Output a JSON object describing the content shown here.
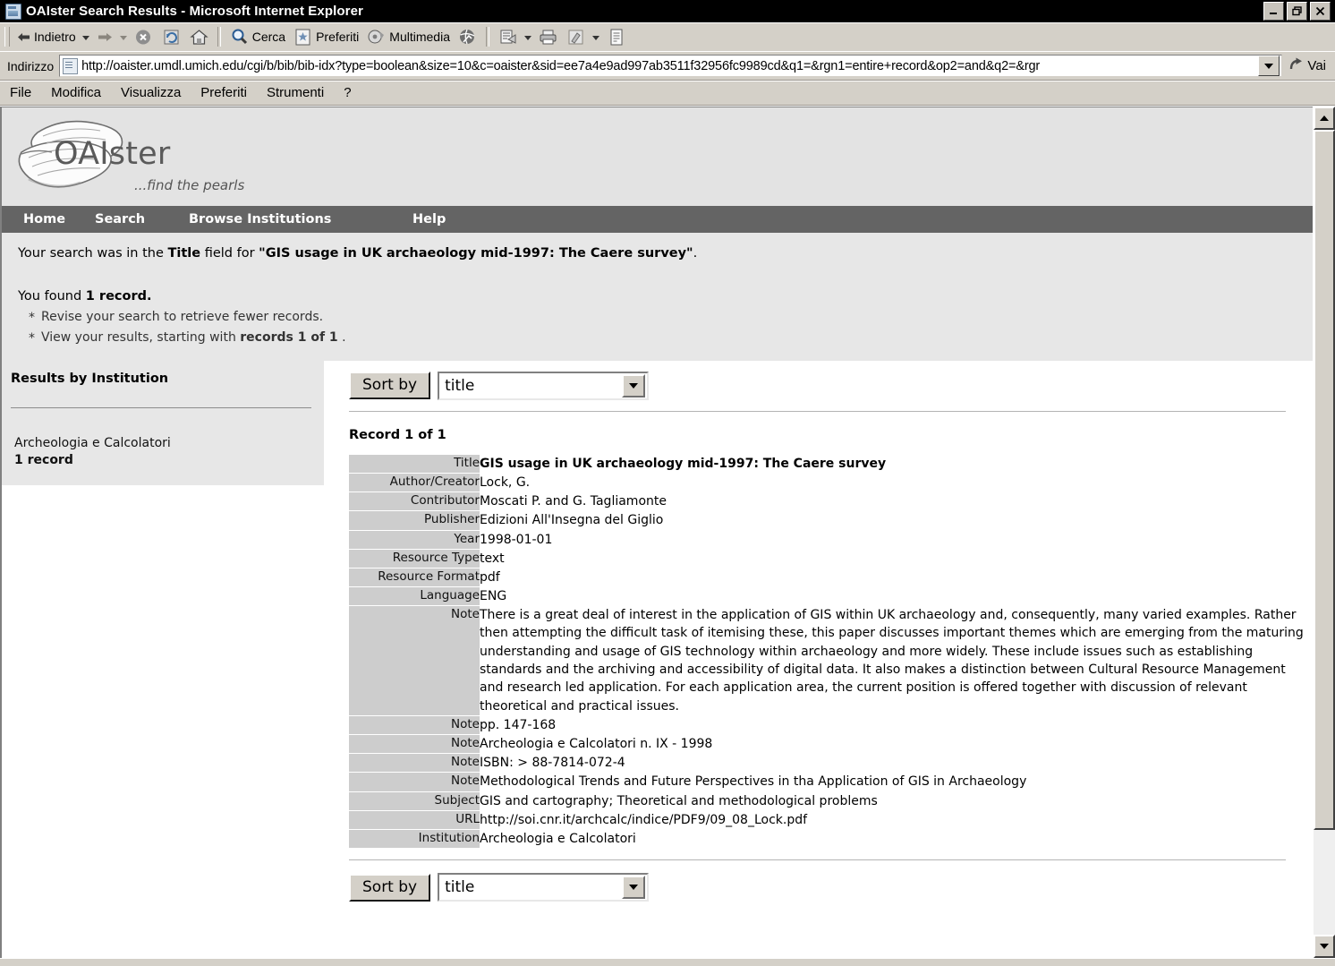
{
  "window": {
    "title": "OAIster Search Results - Microsoft Internet Explorer",
    "minimize_label": "_",
    "restore_label": "❐",
    "close_label": "×"
  },
  "toolbar": {
    "back_label": "Indietro",
    "search_label": "Cerca",
    "favorites_label": "Preferiti",
    "media_label": "Multimedia"
  },
  "address": {
    "label": "Indirizzo",
    "url": "http://oaister.umdl.umich.edu/cgi/b/bib/bib-idx?type=boolean&size=10&c=oaister&sid=ee7a4e9ad997ab3511f32956fc9989cd&q1=&rgn1=entire+record&op2=and&q2=&rgr",
    "go_label": "Vai"
  },
  "menubar": {
    "items": [
      {
        "label": "File"
      },
      {
        "label": "Modifica"
      },
      {
        "label": "Visualizza"
      },
      {
        "label": "Preferiti"
      },
      {
        "label": "Strumenti"
      },
      {
        "label": "?"
      }
    ]
  },
  "masthead": {
    "logo_text": "OAIster",
    "tagline": "...find the pearls"
  },
  "nav": {
    "items": [
      {
        "label": "Home"
      },
      {
        "label": "Search"
      },
      {
        "label": "Browse Institutions"
      },
      {
        "label": "Help"
      }
    ]
  },
  "summary": {
    "line1_prefix": "Your search was in the ",
    "line1_field": "Title",
    "line1_mid": " field for ",
    "line1_query": "\"GIS usage in UK archaeology mid-1997: The Caere survey\"",
    "line1_suffix": ".",
    "found_prefix": "You found ",
    "found_count": "1 record.",
    "bullets": [
      {
        "text": "Revise your search to retrieve fewer records."
      }
    ],
    "bullet2_prefix": "View your results, starting with ",
    "bullet2_bold": "records 1 of 1",
    "bullet2_suffix": "."
  },
  "sidebar": {
    "title": "Results by Institution",
    "institutions": [
      {
        "name": "Archeologia e Calcolatori",
        "count": "1 record"
      }
    ]
  },
  "sort": {
    "button_label": "Sort by",
    "selected": "title"
  },
  "record": {
    "heading": "Record 1 of 1",
    "fields": [
      {
        "label": "Title",
        "value": "GIS usage in UK archaeology mid-1997: The Caere survey",
        "bold": true
      },
      {
        "label": "Author/Creator",
        "value": "Lock, G."
      },
      {
        "label": "Contributor",
        "value": "Moscati P. and G. Tagliamonte"
      },
      {
        "label": "Publisher",
        "value": "Edizioni All'Insegna del Giglio"
      },
      {
        "label": "Year",
        "value": "1998-01-01"
      },
      {
        "label": "Resource Type",
        "value": "text"
      },
      {
        "label": "Resource Format",
        "value": "pdf"
      },
      {
        "label": "Language",
        "value": "ENG"
      },
      {
        "label": "Note",
        "value": "There is a great deal of interest in the application of GIS within UK archaeology and, consequently, many varied examples. Rather then attempting the difficult task of itemising these, this paper discusses important themes which are emerging from the maturing understanding and usage of GIS technology within archaeology and more widely. These include issues such as establishing standards and the archiving and accessibility of digital data. It also makes a distinction between Cultural Resource Management and research led application. For each application area, the current position is offered together with discussion of relevant theoretical and practical issues."
      },
      {
        "label": "Note",
        "value": "pp. 147-168"
      },
      {
        "label": "Note",
        "value": "Archeologia e Calcolatori n. IX - 1998"
      },
      {
        "label": "Note",
        "value": "ISBN: > 88-7814-072-4"
      },
      {
        "label": "Note",
        "value": "Methodological Trends and Future Perspectives in tha Application of GIS in Archaeology"
      },
      {
        "label": "Subject",
        "value": "GIS and cartography; Theoretical and methodological problems"
      },
      {
        "label": "URL",
        "value": "http://soi.cnr.it/archcalc/indice/PDF9/09_08_Lock.pdf"
      },
      {
        "label": "Institution",
        "value": "Archeologia e Calcolatori"
      }
    ]
  },
  "colors": {
    "navbar": "#646464",
    "masthead": "#e3e3e3",
    "summary_bg": "#e7e7e7",
    "label_bg": "#cdcdcd",
    "chrome": "#d4d0c8"
  }
}
